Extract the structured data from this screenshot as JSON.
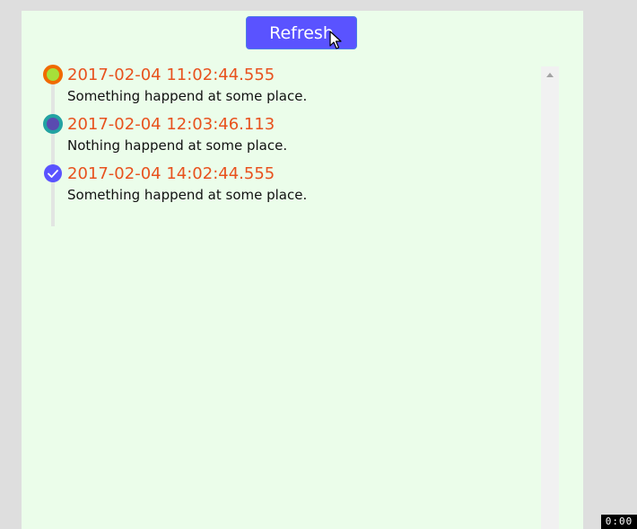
{
  "toolbar": {
    "refresh_label": "Refresh"
  },
  "timeline": {
    "items": [
      {
        "time": "2017-02-04 11:02:44.555",
        "description": "Something happend at some place.",
        "icon": "ring-dot-icon",
        "colors": {
          "ring": "#f06a00",
          "center": "#a6e03a"
        }
      },
      {
        "time": "2017-02-04 12:03:46.113",
        "description": "Nothing happend at some place.",
        "icon": "ring-dot-icon",
        "colors": {
          "ring": "#22a2a2",
          "center": "#5a4bb0"
        }
      },
      {
        "time": "2017-02-04 14:02:44.555",
        "description": "Something happend at some place.",
        "icon": "check-circle-icon",
        "colors": {
          "fill": "#5a53ff",
          "check": "#ffffff"
        }
      }
    ]
  },
  "recorder": {
    "timer": "0:00"
  },
  "colors": {
    "page_background": "#dedede",
    "panel_background": "#ebfdea",
    "button_background": "#5a53ff",
    "time_text": "#e8521e",
    "timeline_line": "#e2e5e2"
  }
}
